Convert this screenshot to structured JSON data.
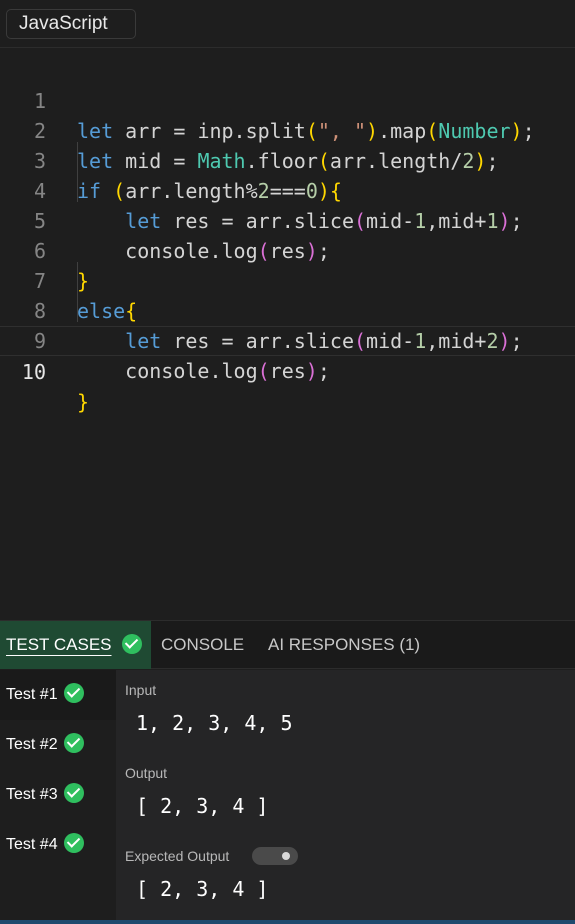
{
  "language": {
    "selected": "JavaScript"
  },
  "editor": {
    "line_numbers": [
      "1",
      "2",
      "3",
      "4",
      "5",
      "6",
      "7",
      "8",
      "9",
      "10"
    ],
    "active_line": "10",
    "code": {
      "l1": [
        "let",
        "arr",
        "=",
        "inp.split",
        "(",
        "\", \"",
        ")",
        ".map",
        "(",
        "Number",
        ")",
        ";"
      ],
      "l2": [
        "let",
        "mid",
        "=",
        "Math",
        ".floor",
        "(",
        "arr.length/",
        "2",
        ")",
        ";"
      ],
      "l3": [
        "if",
        "(",
        "arr.length%",
        "2",
        "===",
        "0",
        ")",
        "{"
      ],
      "l4": [
        "let",
        "res",
        "=",
        "arr.slice",
        "(",
        "mid-",
        "1",
        ",mid+",
        "1",
        ")",
        ";"
      ],
      "l5": [
        "console.log",
        "(",
        "res",
        ")",
        ";"
      ],
      "l6": [
        "}"
      ],
      "l7": [
        "else",
        "{"
      ],
      "l8": [
        "let",
        "res",
        "=",
        "arr.slice",
        "(",
        "mid-",
        "1",
        ",mid+",
        "2",
        ")",
        ";"
      ],
      "l9": [
        "console.log",
        "(",
        "res",
        ")",
        ";"
      ],
      "l10": [
        "}"
      ]
    }
  },
  "panel": {
    "tabs": [
      {
        "label": "TEST CASES",
        "icon": "check-circle-icon"
      },
      {
        "label": "CONSOLE"
      },
      {
        "label": "AI RESPONSES (1)"
      }
    ],
    "tests": [
      {
        "label": "Test #1",
        "status": "passed"
      },
      {
        "label": "Test #2",
        "status": "passed"
      },
      {
        "label": "Test #3",
        "status": "passed"
      },
      {
        "label": "Test #4",
        "status": "passed"
      }
    ],
    "result": {
      "input_label": "Input",
      "input_value": "1, 2, 3, 4, 5",
      "output_label": "Output",
      "output_value": "[ 2, 3, 4 ]",
      "expected_label": "Expected Output",
      "expected_value": "[ 2, 3, 4 ]"
    }
  },
  "colors": {
    "keyword": "#569cd6",
    "string": "#ce9178",
    "class": "#4ec9b0",
    "number": "#b5cea8",
    "active_tab_bg": "#1f4a33",
    "check": "#2fbf5f"
  }
}
